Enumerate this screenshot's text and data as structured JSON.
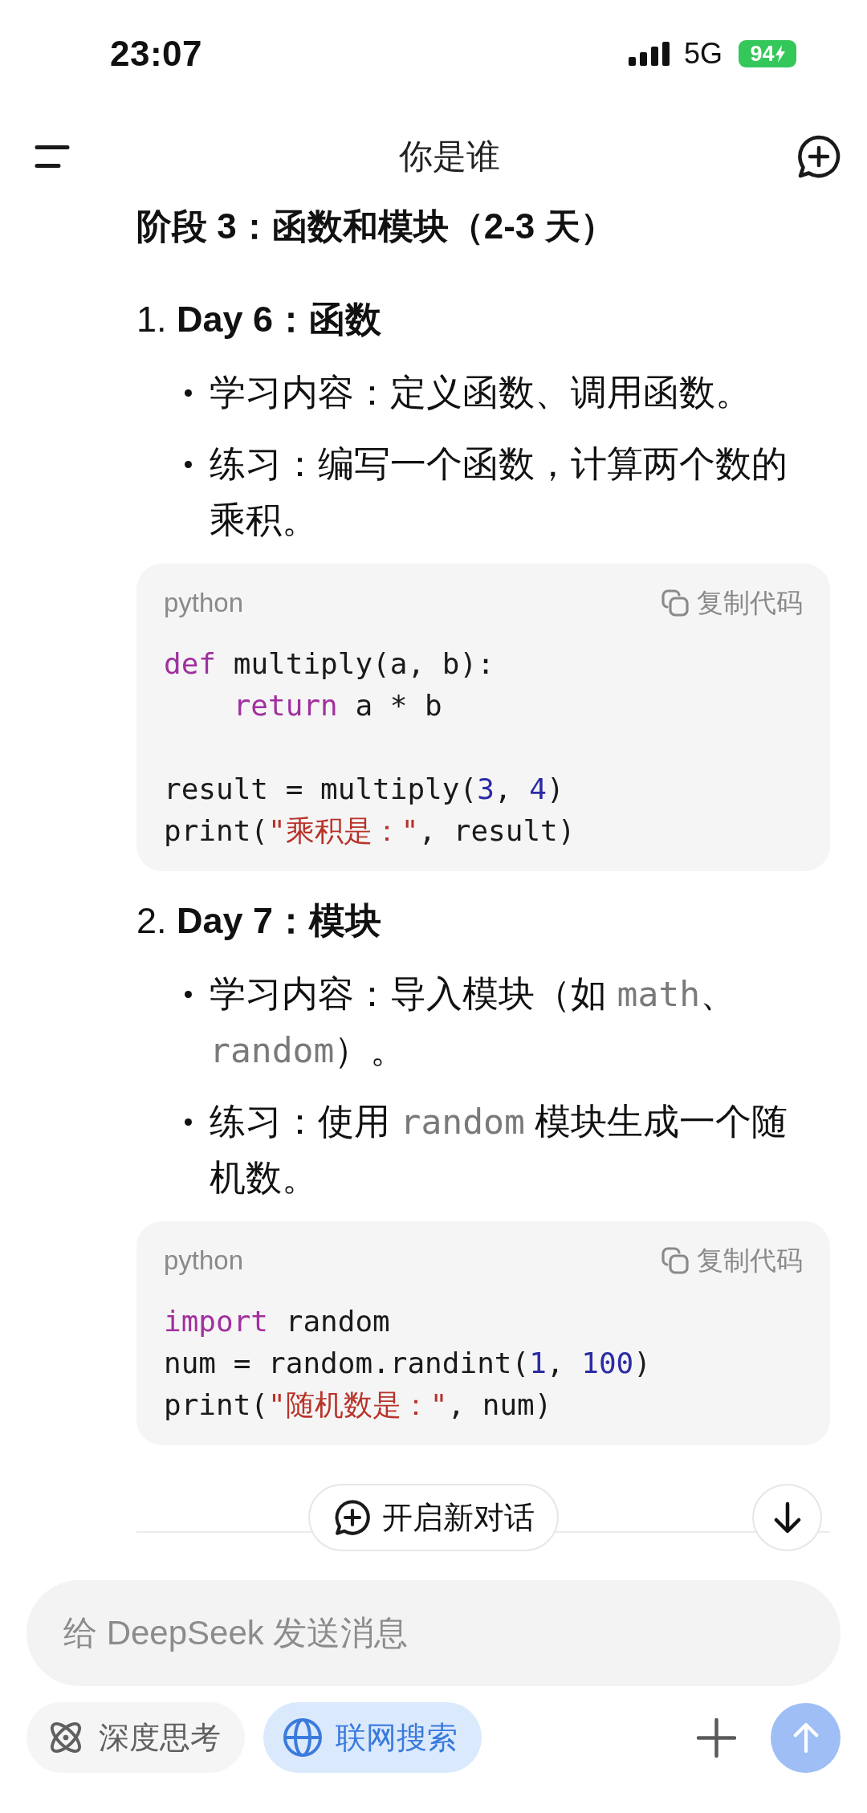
{
  "status_bar": {
    "time": "23:07",
    "network": "5G",
    "battery": "94",
    "charging": true
  },
  "header": {
    "title": "你是谁"
  },
  "conversation": {
    "heading": "阶段 3：函数和模块（2-3 天）",
    "sections": [
      {
        "title": "1. **Day 6：函数**",
        "bullets": [
          {
            "segments": [
              {
                "kind": "text",
                "text": "学习内容：定义函数、调用函数。"
              }
            ]
          },
          {
            "segments": [
              {
                "kind": "text",
                "text": "练习：编写一个函数，计算两个数的乘积。"
              }
            ]
          }
        ],
        "code_block": {
          "language": "python",
          "copy_label": "复制代码",
          "groups": [
            [
              [
                {
                  "kind": "keyword",
                  "text": "def"
                },
                {
                  "kind": "plain",
                  "text": " multiply(a, b):"
                }
              ],
              [
                {
                  "kind": "keyword",
                  "text": "    return"
                },
                {
                  "kind": "plain",
                  "text": " a * b"
                }
              ]
            ],
            [
              [
                {
                  "kind": "plain",
                  "text": "result = multiply("
                },
                {
                  "kind": "number",
                  "text": "3"
                },
                {
                  "kind": "plain",
                  "text": ", "
                },
                {
                  "kind": "number",
                  "text": "4"
                },
                {
                  "kind": "plain",
                  "text": ")"
                }
              ],
              [
                {
                  "kind": "plain",
                  "text": "print("
                },
                {
                  "kind": "string",
                  "text": "\"乘积是：\""
                },
                {
                  "kind": "plain",
                  "text": ", result)"
                }
              ]
            ]
          ]
        }
      },
      {
        "title": "2. **Day 7：模块**",
        "bullets": [
          {
            "segments": [
              {
                "kind": "text",
                "text": "学习内容：导入模块（如 "
              },
              {
                "kind": "code",
                "text": "math"
              },
              {
                "kind": "text",
                "text": "、"
              },
              {
                "kind": "code",
                "text": "random"
              },
              {
                "kind": "text",
                "text": "）。"
              }
            ]
          },
          {
            "segments": [
              {
                "kind": "text",
                "text": "练习：使用 "
              },
              {
                "kind": "code",
                "text": "random"
              },
              {
                "kind": "text",
                "text": " 模块生成一个随机数。"
              }
            ]
          }
        ],
        "code_block": {
          "language": "python",
          "copy_label": "复制代码",
          "groups": [
            [
              [
                {
                  "kind": "keyword",
                  "text": "import"
                },
                {
                  "kind": "plain",
                  "text": " random"
                }
              ],
              [
                {
                  "kind": "plain",
                  "text": "num = random.randint("
                },
                {
                  "kind": "number",
                  "text": "1"
                },
                {
                  "kind": "plain",
                  "text": ", "
                },
                {
                  "kind": "number",
                  "text": "100"
                },
                {
                  "kind": "plain",
                  "text": ")"
                }
              ],
              [
                {
                  "kind": "plain",
                  "text": "print("
                },
                {
                  "kind": "string",
                  "text": "\"随机数是：\""
                },
                {
                  "kind": "plain",
                  "text": ", num)"
                }
              ]
            ]
          ]
        }
      }
    ]
  },
  "new_chat_button": {
    "label": "开启新对话"
  },
  "composer": {
    "placeholder": "给 DeepSeek 发送消息",
    "options": [
      {
        "kind": "think",
        "label": "深度思考",
        "selected": false
      },
      {
        "kind": "search",
        "label": "联网搜索",
        "selected": true
      }
    ],
    "send_button": {
      "disabled": true
    }
  }
}
